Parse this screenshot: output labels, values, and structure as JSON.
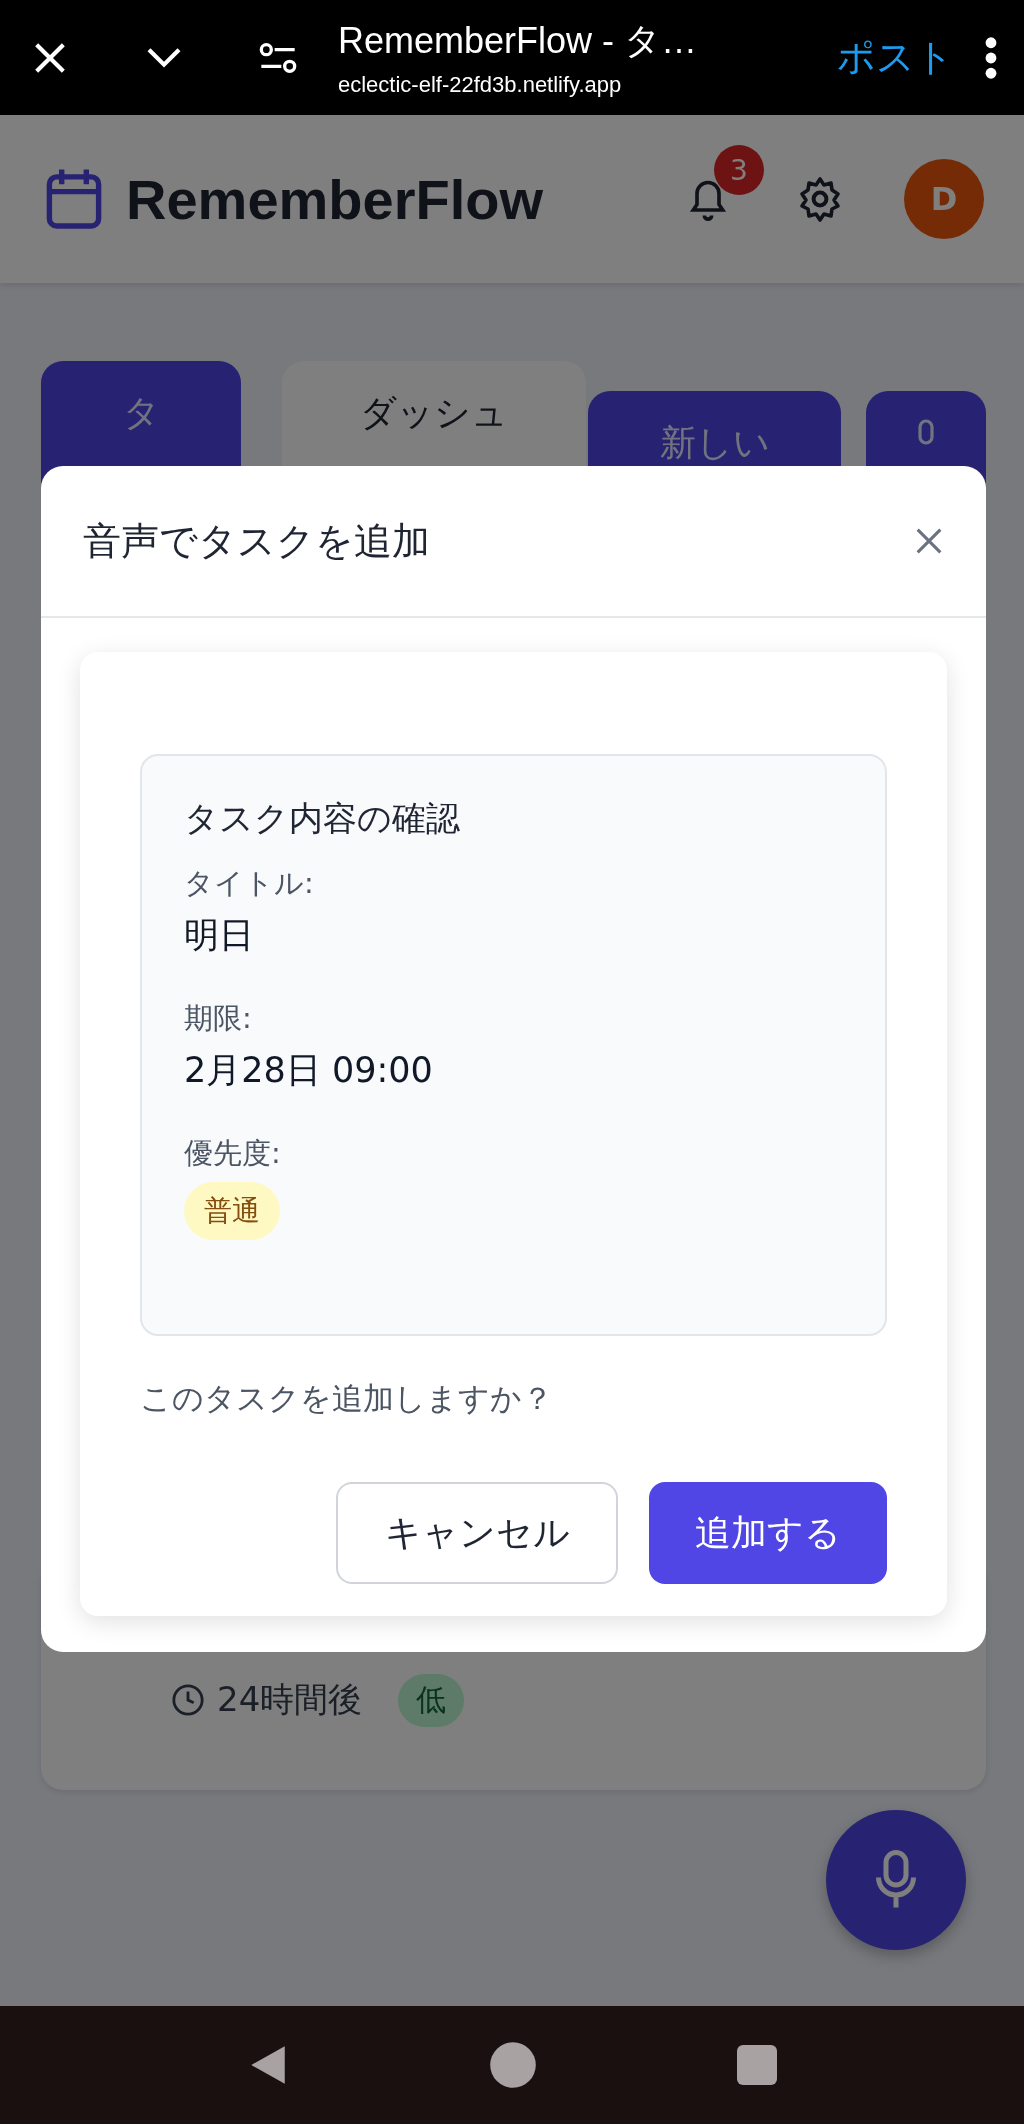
{
  "browser_bar": {
    "title": "RememberFlow - タ…",
    "url": "eclectic-elf-22fd3b.netlify.app",
    "post_label": "ポスト"
  },
  "header": {
    "app_name": "RememberFlow",
    "notification_count": "3",
    "avatar_letter": "D"
  },
  "tabs": [
    {
      "label": "タ",
      "kind": "primary"
    },
    {
      "label": "ダッシュ",
      "kind": "secondary"
    },
    {
      "label": "新しい",
      "kind": "primary"
    },
    {
      "kind": "icon"
    }
  ],
  "background_task": {
    "due": "24時間後",
    "priority": "低"
  },
  "modal": {
    "title": "音声でタスクを追加",
    "confirm_title": "タスク内容の確認",
    "fields": [
      {
        "label": "タイトル:",
        "value": "明日",
        "kind": "text"
      },
      {
        "label": "期限:",
        "value": "2月28日 09:00",
        "kind": "text"
      },
      {
        "label": "優先度:",
        "value": "普通",
        "kind": "badge"
      }
    ],
    "question": "このタスクを追加しますか？",
    "buttons": [
      {
        "label": "キャンセル",
        "kind": "secondary"
      },
      {
        "label": "追加する",
        "kind": "primary"
      }
    ]
  }
}
